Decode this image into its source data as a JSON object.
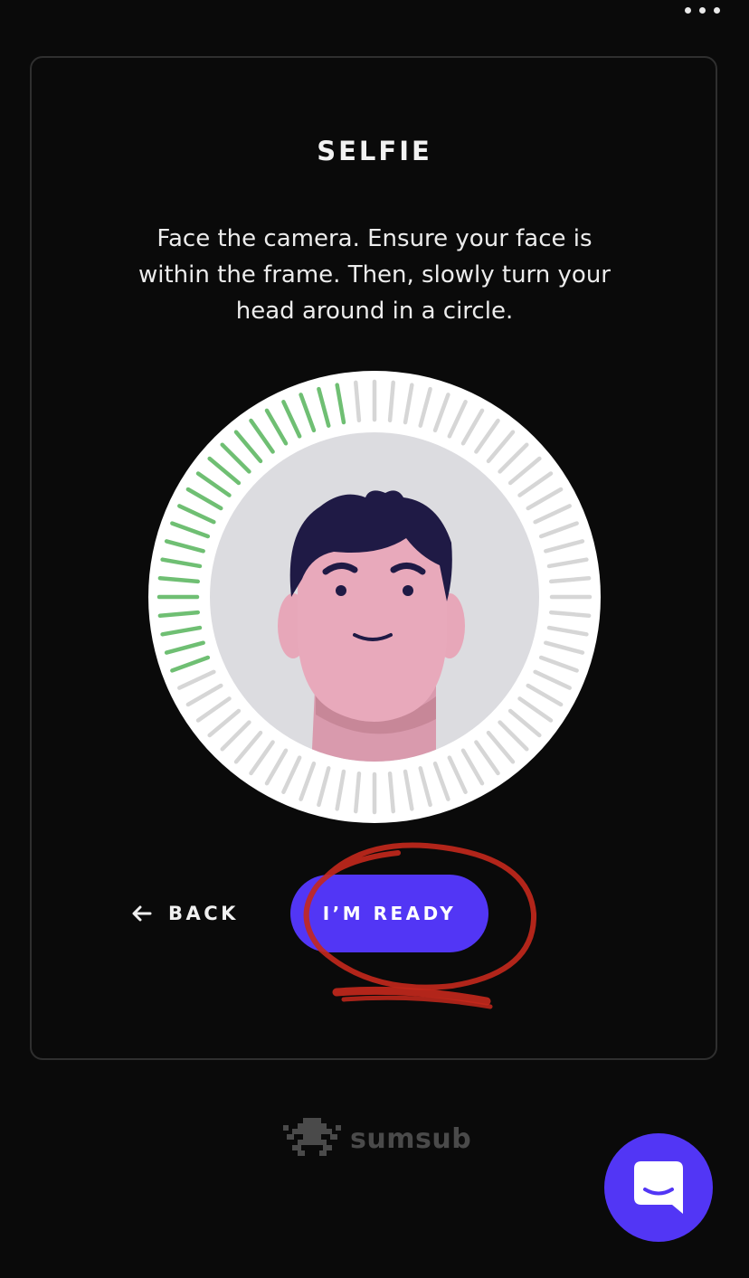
{
  "header": {
    "menu_icon": "more-horizontal-icon"
  },
  "selfie": {
    "title": "SELFIE",
    "instructions": "Face the camera. Ensure your face is\nwithin the frame. Then, slowly turn your\nhead around in a circle.",
    "progress_colors": {
      "done": "#6fbf73",
      "pending": "#d6d6d6"
    }
  },
  "actions": {
    "back_label": "BACK",
    "back_icon": "arrow-left-icon",
    "ready_label": "I’M READY"
  },
  "branding": {
    "name": "sumsub",
    "logo_icon": "sumsub-logo-icon"
  },
  "chat": {
    "icon": "chat-bubble-icon"
  },
  "colors": {
    "accent": "#5236f5",
    "background": "#0a0a0a",
    "annotation": "#d3362a"
  }
}
